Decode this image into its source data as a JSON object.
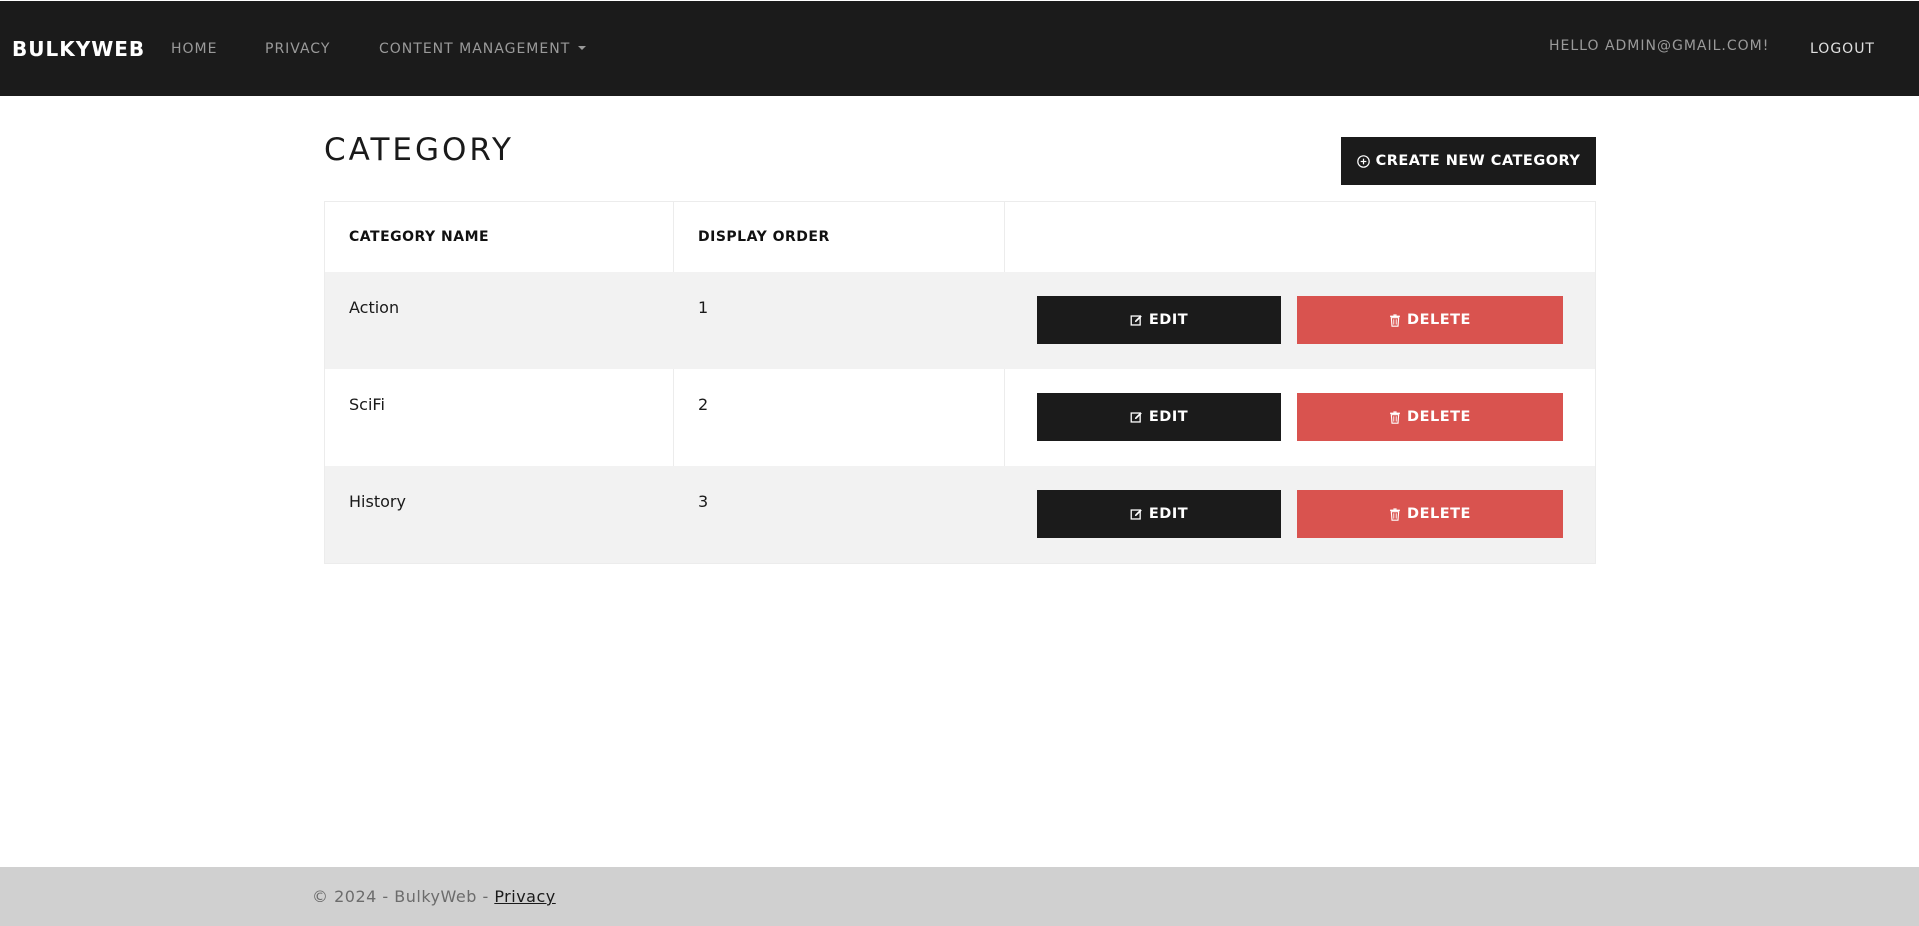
{
  "navbar": {
    "brand": "BULKYWEB",
    "links": {
      "home": "HOME",
      "privacy": "PRIVACY",
      "content_management": "CONTENT MANAGEMENT"
    },
    "greeting": "HELLO ADMIN@GMAIL.COM!",
    "logout": "LOGOUT"
  },
  "page": {
    "title": "CATEGORY",
    "create_button": "CREATE NEW CATEGORY"
  },
  "table": {
    "columns": [
      "CATEGORY NAME",
      "DISPLAY ORDER"
    ],
    "rows": [
      {
        "name": "Action",
        "order": "1",
        "edit": "EDIT",
        "delete": "DELETE"
      },
      {
        "name": "SciFi",
        "order": "2",
        "edit": "EDIT",
        "delete": "DELETE"
      },
      {
        "name": "History",
        "order": "3",
        "edit": "EDIT",
        "delete": "DELETE"
      }
    ]
  },
  "footer": {
    "text": "© 2024 - BulkyWeb - ",
    "privacy_link": "Privacy"
  },
  "icons": {
    "create": "plus-circle-icon",
    "edit": "edit-square-icon",
    "delete": "trash-icon"
  },
  "colors": {
    "navbar": "#1b1b1b",
    "dark_button": "#1b1b1b",
    "danger_button": "#d9534f",
    "stripe_row": "#f2f2f2",
    "footer": "#d0d0d0"
  }
}
